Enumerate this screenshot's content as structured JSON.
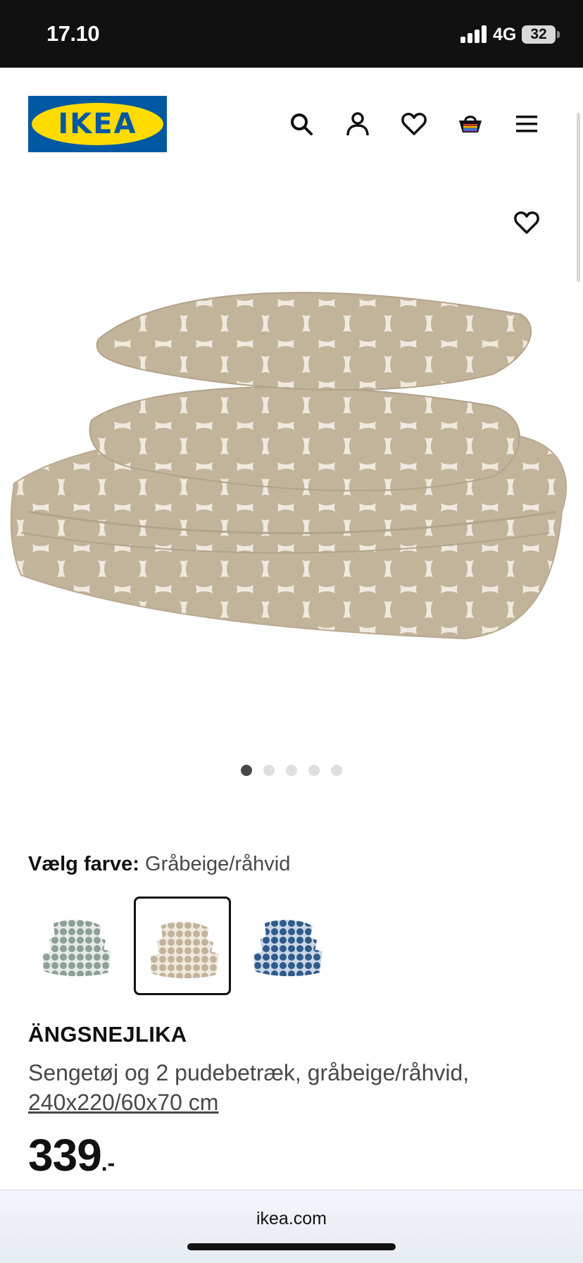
{
  "status_bar": {
    "time": "17.10",
    "network": "4G",
    "battery": "32"
  },
  "header": {
    "logo_text": "IKEA",
    "icons": [
      "search-icon",
      "user-icon",
      "heart-icon",
      "basket-icon",
      "menu-icon"
    ]
  },
  "gallery": {
    "image_count": 5,
    "active_index": 0
  },
  "color_select": {
    "label": "Vælg farve:",
    "value": "Gråbeige/råhvid",
    "options": [
      "green-variant",
      "beige-variant",
      "blue-variant"
    ],
    "selected_index": 1
  },
  "product": {
    "name": "ÄNGSNEJLIKA",
    "description": "Sengetøj og 2 pudebetræk, gråbeige/råhvid,",
    "size": "240x220/60x70 cm",
    "price_integer": "339",
    "price_suffix": ".-"
  },
  "browser": {
    "url": "ikea.com"
  },
  "colors": {
    "status_bg": "#111111",
    "logo_blue": "#0058a3",
    "logo_yellow": "#ffdb00",
    "fabric_beige": "#c2b39b",
    "fabric_light": "#efe9df",
    "swatch_green": "#8ea096",
    "swatch_blue": "#2f5b88"
  }
}
